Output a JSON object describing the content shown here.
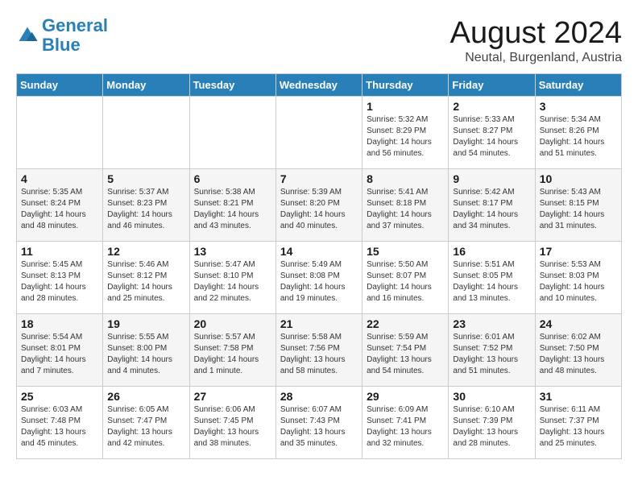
{
  "logo": {
    "text_general": "General",
    "text_blue": "Blue"
  },
  "title": {
    "month_year": "August 2024",
    "location": "Neutal, Burgenland, Austria"
  },
  "days_of_week": [
    "Sunday",
    "Monday",
    "Tuesday",
    "Wednesday",
    "Thursday",
    "Friday",
    "Saturday"
  ],
  "weeks": [
    [
      {
        "day": "",
        "info": ""
      },
      {
        "day": "",
        "info": ""
      },
      {
        "day": "",
        "info": ""
      },
      {
        "day": "",
        "info": ""
      },
      {
        "day": "1",
        "info": "Sunrise: 5:32 AM\nSunset: 8:29 PM\nDaylight: 14 hours\nand 56 minutes."
      },
      {
        "day": "2",
        "info": "Sunrise: 5:33 AM\nSunset: 8:27 PM\nDaylight: 14 hours\nand 54 minutes."
      },
      {
        "day": "3",
        "info": "Sunrise: 5:34 AM\nSunset: 8:26 PM\nDaylight: 14 hours\nand 51 minutes."
      }
    ],
    [
      {
        "day": "4",
        "info": "Sunrise: 5:35 AM\nSunset: 8:24 PM\nDaylight: 14 hours\nand 48 minutes."
      },
      {
        "day": "5",
        "info": "Sunrise: 5:37 AM\nSunset: 8:23 PM\nDaylight: 14 hours\nand 46 minutes."
      },
      {
        "day": "6",
        "info": "Sunrise: 5:38 AM\nSunset: 8:21 PM\nDaylight: 14 hours\nand 43 minutes."
      },
      {
        "day": "7",
        "info": "Sunrise: 5:39 AM\nSunset: 8:20 PM\nDaylight: 14 hours\nand 40 minutes."
      },
      {
        "day": "8",
        "info": "Sunrise: 5:41 AM\nSunset: 8:18 PM\nDaylight: 14 hours\nand 37 minutes."
      },
      {
        "day": "9",
        "info": "Sunrise: 5:42 AM\nSunset: 8:17 PM\nDaylight: 14 hours\nand 34 minutes."
      },
      {
        "day": "10",
        "info": "Sunrise: 5:43 AM\nSunset: 8:15 PM\nDaylight: 14 hours\nand 31 minutes."
      }
    ],
    [
      {
        "day": "11",
        "info": "Sunrise: 5:45 AM\nSunset: 8:13 PM\nDaylight: 14 hours\nand 28 minutes."
      },
      {
        "day": "12",
        "info": "Sunrise: 5:46 AM\nSunset: 8:12 PM\nDaylight: 14 hours\nand 25 minutes."
      },
      {
        "day": "13",
        "info": "Sunrise: 5:47 AM\nSunset: 8:10 PM\nDaylight: 14 hours\nand 22 minutes."
      },
      {
        "day": "14",
        "info": "Sunrise: 5:49 AM\nSunset: 8:08 PM\nDaylight: 14 hours\nand 19 minutes."
      },
      {
        "day": "15",
        "info": "Sunrise: 5:50 AM\nSunset: 8:07 PM\nDaylight: 14 hours\nand 16 minutes."
      },
      {
        "day": "16",
        "info": "Sunrise: 5:51 AM\nSunset: 8:05 PM\nDaylight: 14 hours\nand 13 minutes."
      },
      {
        "day": "17",
        "info": "Sunrise: 5:53 AM\nSunset: 8:03 PM\nDaylight: 14 hours\nand 10 minutes."
      }
    ],
    [
      {
        "day": "18",
        "info": "Sunrise: 5:54 AM\nSunset: 8:01 PM\nDaylight: 14 hours\nand 7 minutes."
      },
      {
        "day": "19",
        "info": "Sunrise: 5:55 AM\nSunset: 8:00 PM\nDaylight: 14 hours\nand 4 minutes."
      },
      {
        "day": "20",
        "info": "Sunrise: 5:57 AM\nSunset: 7:58 PM\nDaylight: 14 hours\nand 1 minute."
      },
      {
        "day": "21",
        "info": "Sunrise: 5:58 AM\nSunset: 7:56 PM\nDaylight: 13 hours\nand 58 minutes."
      },
      {
        "day": "22",
        "info": "Sunrise: 5:59 AM\nSunset: 7:54 PM\nDaylight: 13 hours\nand 54 minutes."
      },
      {
        "day": "23",
        "info": "Sunrise: 6:01 AM\nSunset: 7:52 PM\nDaylight: 13 hours\nand 51 minutes."
      },
      {
        "day": "24",
        "info": "Sunrise: 6:02 AM\nSunset: 7:50 PM\nDaylight: 13 hours\nand 48 minutes."
      }
    ],
    [
      {
        "day": "25",
        "info": "Sunrise: 6:03 AM\nSunset: 7:48 PM\nDaylight: 13 hours\nand 45 minutes."
      },
      {
        "day": "26",
        "info": "Sunrise: 6:05 AM\nSunset: 7:47 PM\nDaylight: 13 hours\nand 42 minutes."
      },
      {
        "day": "27",
        "info": "Sunrise: 6:06 AM\nSunset: 7:45 PM\nDaylight: 13 hours\nand 38 minutes."
      },
      {
        "day": "28",
        "info": "Sunrise: 6:07 AM\nSunset: 7:43 PM\nDaylight: 13 hours\nand 35 minutes."
      },
      {
        "day": "29",
        "info": "Sunrise: 6:09 AM\nSunset: 7:41 PM\nDaylight: 13 hours\nand 32 minutes."
      },
      {
        "day": "30",
        "info": "Sunrise: 6:10 AM\nSunset: 7:39 PM\nDaylight: 13 hours\nand 28 minutes."
      },
      {
        "day": "31",
        "info": "Sunrise: 6:11 AM\nSunset: 7:37 PM\nDaylight: 13 hours\nand 25 minutes."
      }
    ]
  ]
}
